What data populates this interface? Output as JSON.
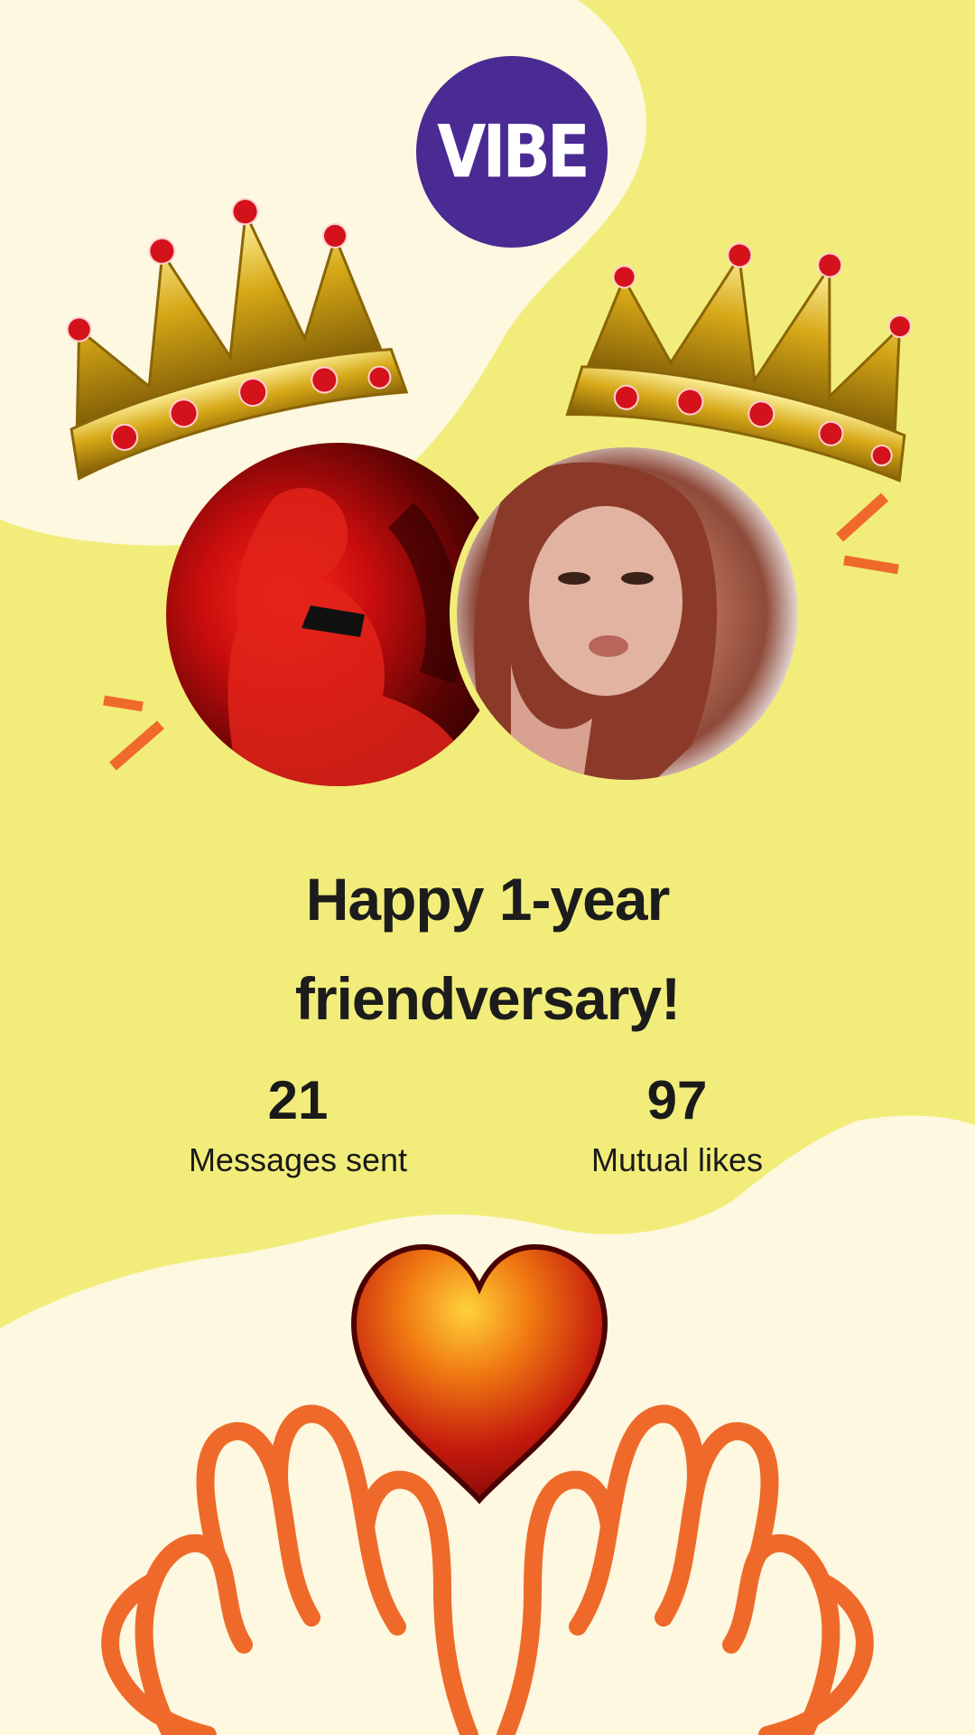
{
  "brand": {
    "logo_text": "VIBE",
    "logo_color": "#4a2a93"
  },
  "colors": {
    "background": "#f2ed7a",
    "cream": "#fdf8df",
    "accent": "#ef6a2a",
    "heart": "#c4190d"
  },
  "profiles": [
    {
      "icon": "friend-photo-left",
      "crown": "gold-crown-icon"
    },
    {
      "icon": "friend-photo-right",
      "crown": "gold-crown-icon"
    }
  ],
  "headline": {
    "line1": "Happy 1-year",
    "line2": "friendversary!"
  },
  "stats": [
    {
      "value": "21",
      "label": "Messages sent"
    },
    {
      "value": "97",
      "label": "Mutual likes"
    }
  ],
  "decorations": {
    "heart": "red-heart-icon",
    "hands": "hands-illustration"
  }
}
